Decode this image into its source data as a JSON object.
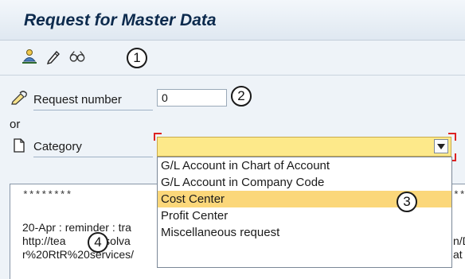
{
  "window": {
    "title": "Request for Master Data"
  },
  "toolbar": {
    "icons": [
      "person-assign-icon",
      "pencil-icon",
      "glasses-icon"
    ]
  },
  "callouts": [
    "1",
    "2",
    "3",
    "4"
  ],
  "form": {
    "request_number_label": "Request number",
    "request_number_value": "0",
    "or_label": "or",
    "category_label": "Category",
    "category_value": ""
  },
  "dropdown": {
    "options": [
      "G/L Account in Chart of Account",
      "G/L Account in Company Code",
      "Cost Center",
      "Profit Center",
      "Miscellaneous request"
    ],
    "highlighted": "Cost Center"
  },
  "notes": {
    "stars_left": "********",
    "stars_right": "**",
    "line1": "20-Apr : reminder : tra",
    "line2_left": "http://tea",
    "line2_right": "es.solva",
    "line2_end": "n/D",
    "line3_left": "r%20RtR%20services/",
    "line3_end": "at"
  },
  "colors": {
    "highlight": "#fbd77a",
    "combo_fill": "#fde98a",
    "title": "#0c2a4d"
  }
}
